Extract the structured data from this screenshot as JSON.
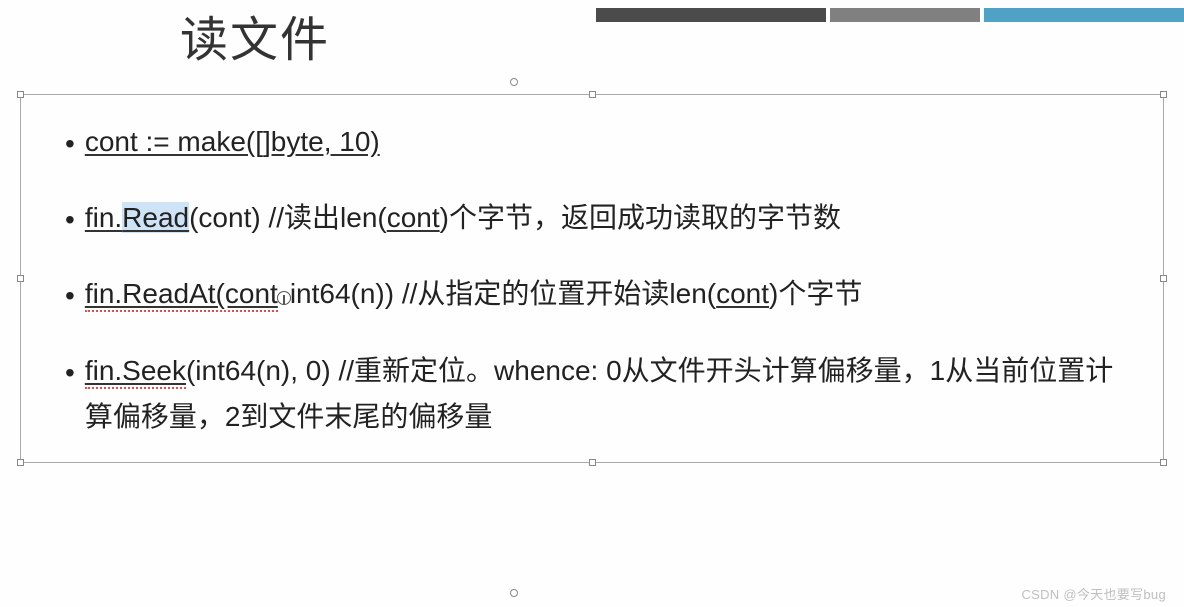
{
  "title": "读文件",
  "bullets": {
    "b1_code": "cont := make([]byte, 10)",
    "b2_prefix": "fin.",
    "b2_read": "Read",
    "b2_after": "(cont) //读出len(",
    "b2_cont": "cont",
    "b2_tail": ")个字节，返回成功读取的字节数",
    "b3_code": "fin.ReadAt(cont",
    "b3_mid": "int64(n)) //从指定的位置开始读len(",
    "b3_cont": "cont",
    "b3_tail": ")个字节",
    "b4_code": "fin.Seek",
    "b4_rest": "(int64(n), 0) //重新定位。whence: 0从文件开头计算偏移量，1从当前位置计算偏移量，2到文件末尾的偏移量"
  },
  "watermark": "CSDN @今天也要写bug"
}
